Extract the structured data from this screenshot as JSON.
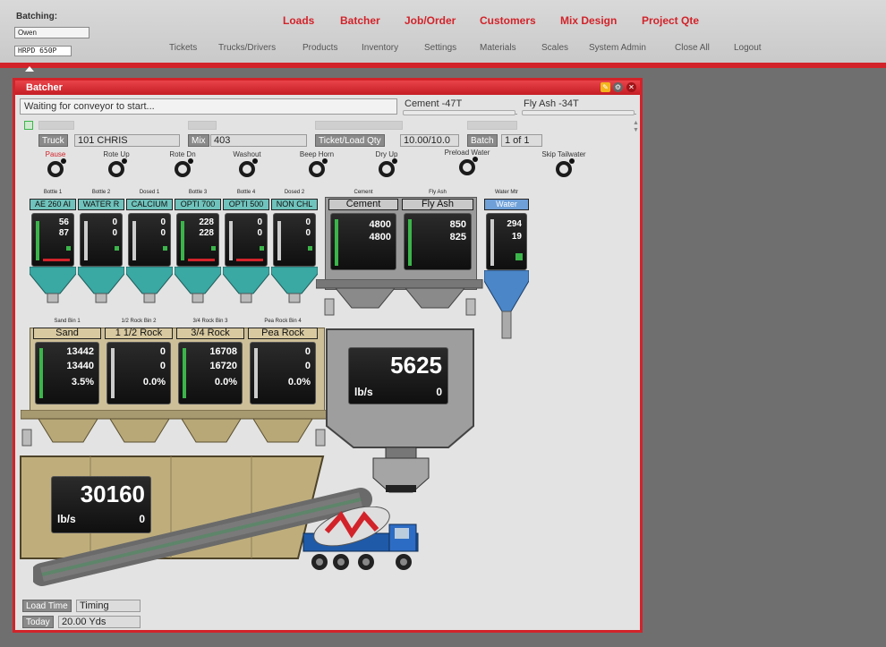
{
  "header": {
    "batching_label": "Batching:",
    "batching_value": "Owen",
    "plant": "HRPD 650P",
    "nav_primary": [
      "Loads",
      "Batcher",
      "Job/Order",
      "Customers",
      "Mix Design",
      "Project Qte"
    ],
    "nav_secondary": [
      "Tickets",
      "Trucks/Drivers",
      "Products",
      "Inventory",
      "Settings",
      "Materials",
      "Scales",
      "System Admin",
      "Close All",
      "Logout"
    ]
  },
  "window": {
    "title": "Batcher",
    "status": "Waiting for conveyor to start...",
    "inventory": [
      {
        "label": "Cement -47T"
      },
      {
        "label": "Fly Ash -34T"
      }
    ]
  },
  "fields": {
    "truck_label": "Truck",
    "truck_value": "101 CHRIS",
    "mix_label": "Mix",
    "mix_value": "403",
    "ticket_label": "Ticket/Load Qty",
    "ticket_value": "10.00/10.0",
    "batch_label": "Batch",
    "batch_value": "1 of 1"
  },
  "controls": [
    "Pause",
    "Rote Up",
    "Rote Dn",
    "Washout",
    "Beep Horn",
    "Dry Up",
    "Preload Water",
    "Skip Tailwater"
  ],
  "admix": [
    {
      "top": "Bottle 1",
      "name": "AE 260 AI",
      "v1": "56",
      "v2": "87"
    },
    {
      "top": "Bottle 2",
      "name": "WATER R",
      "v1": "0",
      "v2": "0"
    },
    {
      "top": "Dosed 1",
      "name": "CALCIUM",
      "v1": "0",
      "v2": "0"
    },
    {
      "top": "Bottle 3",
      "name": "OPTI 700",
      "v1": "228",
      "v2": "228"
    },
    {
      "top": "Bottle 4",
      "name": "OPTI 500",
      "v1": "0",
      "v2": "0"
    },
    {
      "top": "Dosed 2",
      "name": "NON CHL",
      "v1": "0",
      "v2": "0"
    }
  ],
  "cement_bins": [
    {
      "top": "Cement",
      "name": "Cement",
      "v1": "4800",
      "v2": "4800"
    },
    {
      "top": "Fly Ash",
      "name": "Fly Ash",
      "v1": "850",
      "v2": "825"
    }
  ],
  "water": {
    "top": "Water Mtr",
    "name": "Water",
    "v1": "294",
    "v2": "19"
  },
  "aggregates": [
    {
      "top": "Sand Bin 1",
      "name": "Sand",
      "v1": "13442",
      "v2": "13440",
      "v3": "3.5%"
    },
    {
      "top": "1/2 Rock Bin 2",
      "name": "1 1/2 Rock",
      "v1": "0",
      "v2": "0",
      "v3": "0.0%"
    },
    {
      "top": "3/4 Rock Bin 3",
      "name": "3/4 Rock",
      "v1": "16708",
      "v2": "16720",
      "v3": "0.0%"
    },
    {
      "top": "Pea Rock Bin 4",
      "name": "Pea Rock",
      "v1": "0",
      "v2": "0",
      "v3": "0.0%"
    }
  ],
  "cement_scale": {
    "value": "5625",
    "unit": "lb/s",
    "rate": "0"
  },
  "agg_scale": {
    "value": "30160",
    "unit": "lb/s",
    "rate": "0"
  },
  "footer": {
    "load_time_label": "Load Time",
    "load_time_value": "Timing",
    "today_label": "Today",
    "today_value": "20.00 Yds"
  },
  "colors": {
    "accent": "#d2232a",
    "admix": "#3aa8a3",
    "cement": "#8c8c8c",
    "water": "#4a86c8",
    "aggregate": "#c9b88e"
  }
}
